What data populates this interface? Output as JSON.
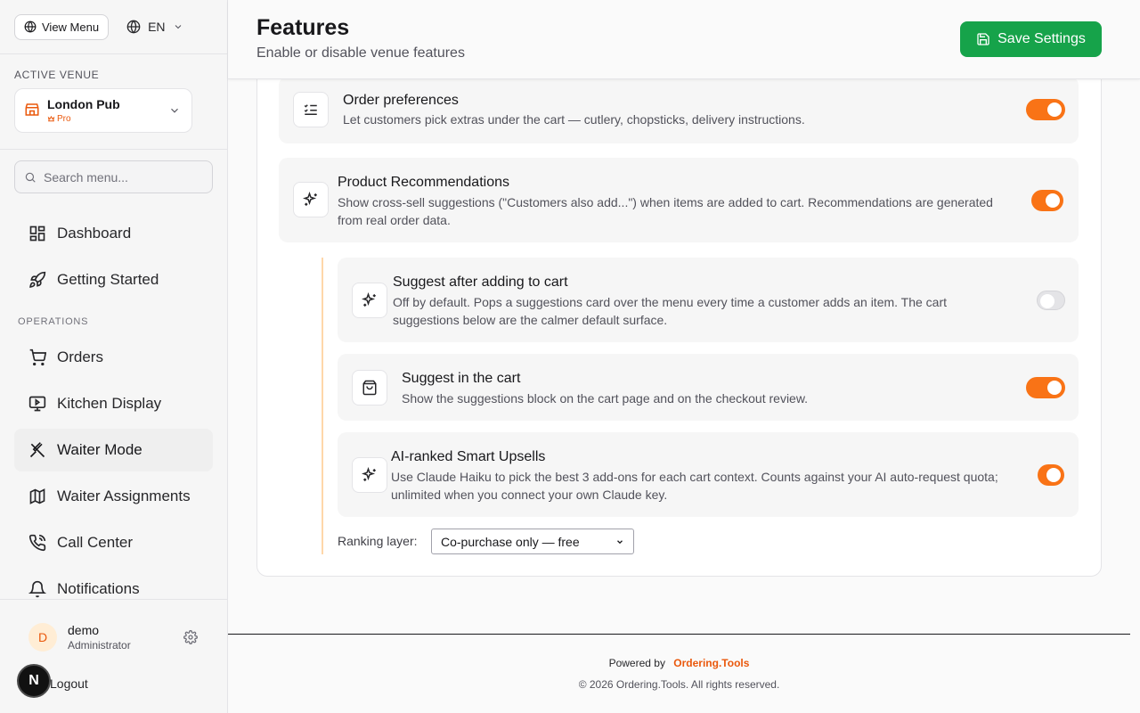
{
  "sidebar": {
    "view_menu": "View Menu",
    "language": "EN",
    "active_venue_label": "ACTIVE VENUE",
    "venue_name": "London Pub",
    "venue_plan": "Pro",
    "search_placeholder": "Search menu...",
    "nav": [
      {
        "label": "Dashboard",
        "icon": "dashboard-icon"
      },
      {
        "label": "Getting Started",
        "icon": "rocket-icon"
      },
      {
        "label": "Orders",
        "icon": "cart-icon"
      },
      {
        "label": "Kitchen Display",
        "icon": "monitor-icon"
      },
      {
        "label": "Waiter Mode",
        "icon": "utensils-icon",
        "active": true
      },
      {
        "label": "Waiter Assignments",
        "icon": "map-icon"
      },
      {
        "label": "Call Center",
        "icon": "phone-icon"
      },
      {
        "label": "Notifications",
        "icon": "bell-icon"
      }
    ],
    "operations_label": "OPERATIONS",
    "user": {
      "initial": "D",
      "name": "demo",
      "role": "Administrator"
    },
    "logout": "Logout",
    "badge": "N"
  },
  "header": {
    "title": "Features",
    "subtitle": "Enable or disable venue features",
    "save_label": "Save Settings"
  },
  "features": [
    {
      "title": "Order preferences",
      "desc": "Let customers pick extras under the cart — cutlery, chopsticks, delivery instructions.",
      "enabled": true
    },
    {
      "title": "Product Recommendations",
      "desc": "Show cross-sell suggestions (\"Customers also add...\") when items are added to cart. Recommendations are generated from real order data.",
      "enabled": true
    },
    {
      "title": "Suggest after adding to cart",
      "desc": "Off by default. Pops a suggestions card over the menu every time a customer adds an item. The cart suggestions below are the calmer default surface.",
      "enabled": false
    },
    {
      "title": "Suggest in the cart",
      "desc": "Show the suggestions block on the cart page and on the checkout review.",
      "enabled": true
    },
    {
      "title": "AI-ranked Smart Upsells",
      "desc": "Use Claude Haiku to pick the best 3 add-ons for each cart context. Counts against your AI auto-request quota; unlimited when you connect your own Claude key.",
      "enabled": true
    }
  ],
  "ranking": {
    "label": "Ranking layer:",
    "selected": "Co-purchase only — free"
  },
  "footer": {
    "powered_by": "Powered by",
    "brand": "Ordering.Tools",
    "copyright": "© 2026 Ordering.Tools. All rights reserved."
  },
  "colors": {
    "accent": "#f97316",
    "save": "#16a34a",
    "brand": "#ea580c"
  }
}
